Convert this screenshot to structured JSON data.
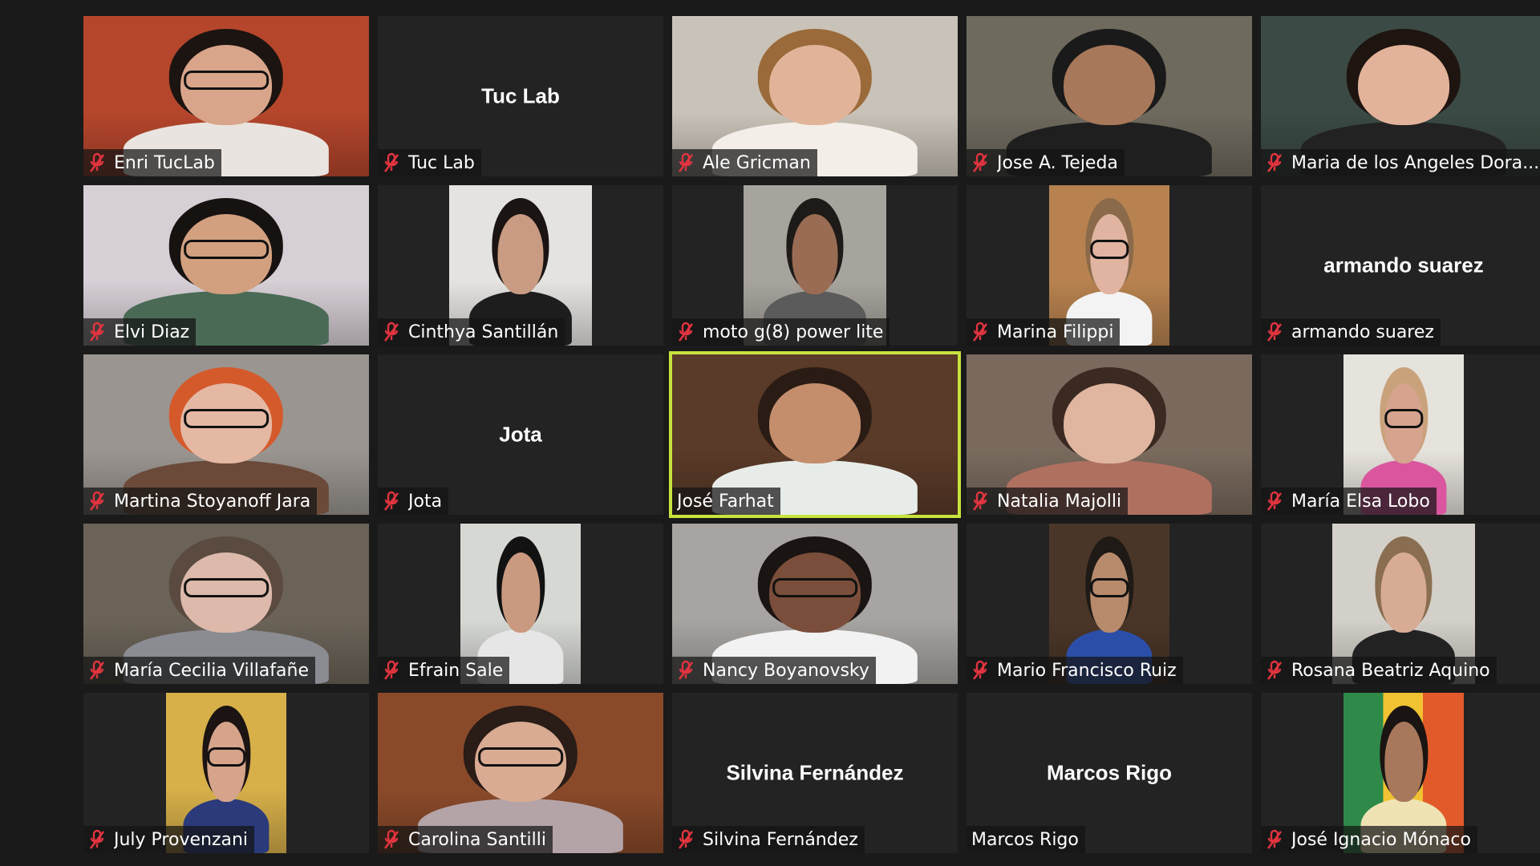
{
  "meeting": {
    "participants": [
      {
        "name": "Enri TucLab",
        "muted": true,
        "video": true,
        "bg": "#b5462c",
        "skin": "#d9a58a",
        "shirt": "#e9e4df",
        "hair": "#1c1410",
        "wide": true,
        "glasses": true
      },
      {
        "name": "Tuc Lab",
        "muted": true,
        "video": false,
        "display": "Tuc Lab"
      },
      {
        "name": "Ale Gricman",
        "muted": true,
        "video": true,
        "bg": "#c9c2b8",
        "skin": "#e1b49a",
        "shirt": "#f3eee8",
        "hair": "#9a6a3a",
        "wide": true
      },
      {
        "name": "Jose A. Tejeda",
        "muted": true,
        "video": true,
        "bg": "#6e6a5e",
        "skin": "#a8785a",
        "shirt": "#1f1f1f",
        "hair": "#1a1a1a",
        "wide": true
      },
      {
        "name": "Maria de los Angeles Dora...",
        "muted": true,
        "video": true,
        "bg": "#3b4a44",
        "skin": "#e2b39a",
        "shirt": "#222222",
        "hair": "#1e1410",
        "wide": true
      },
      {
        "name": "Elvi Diaz",
        "muted": true,
        "video": true,
        "bg": "#d7cfd6",
        "skin": "#d2a07f",
        "shirt": "#4a6a55",
        "hair": "#161210",
        "wide": true,
        "glasses": true
      },
      {
        "name": "Cinthya Santillán",
        "muted": true,
        "video": true,
        "bg": "#e4e3e1",
        "skin": "#c89b82",
        "shirt": "#1d1d1d",
        "hair": "#1a1412",
        "wide": false
      },
      {
        "name": "moto g(8) power lite",
        "muted": true,
        "video": true,
        "bg": "#a7a39d",
        "skin": "#9a6c54",
        "shirt": "#5b5b5b",
        "hair": "#1e1a18",
        "wide": false,
        "mid": true
      },
      {
        "name": "Marina Filippi",
        "muted": true,
        "video": true,
        "bg": "#b7824f",
        "skin": "#e0b4a0",
        "shirt": "#f3f3f3",
        "hair": "#8a6a4a",
        "wide": false,
        "vnarrow": true,
        "glasses": true
      },
      {
        "name": "armando suarez",
        "muted": true,
        "video": false,
        "display": "armando suarez"
      },
      {
        "name": "Martina Stoyanoff Jara",
        "muted": true,
        "video": true,
        "bg": "#9a9590",
        "skin": "#e5b8a4",
        "shirt": "#6b4a3a",
        "hair": "#d45a2c",
        "wide": true,
        "glasses": true
      },
      {
        "name": "Jota",
        "muted": true,
        "video": false,
        "display": "Jota"
      },
      {
        "name": "José Farhat",
        "muted": false,
        "video": true,
        "active": true,
        "bg": "#5a3a28",
        "skin": "#c48e6c",
        "shirt": "#e8ece8",
        "hair": "#2a1c14",
        "wide": true
      },
      {
        "name": "Natalia Majolli",
        "muted": true,
        "video": true,
        "bg": "#7a6a5e",
        "skin": "#e0b6a0",
        "shirt": "#b07060",
        "hair": "#3a2a22",
        "wide": true
      },
      {
        "name": "María Elsa Lobo",
        "muted": true,
        "video": true,
        "bg": "#e6e2dc",
        "skin": "#d6a48e",
        "shirt": "#d9569e",
        "hair": "#c9a27c",
        "wide": false,
        "vnarrow": true,
        "glasses": true
      },
      {
        "name": "María Cecilia Villafañe",
        "muted": true,
        "video": true,
        "bg": "#6b6358",
        "skin": "#dcb9aa",
        "shirt": "#8a8c92",
        "hair": "#5a4a40",
        "wide": true,
        "glasses": true
      },
      {
        "name": "Efrain Sale",
        "muted": true,
        "video": true,
        "bg": "#d6d8d4",
        "skin": "#c99a80",
        "shirt": "#e6e6e6",
        "hair": "#121212",
        "wide": false,
        "vnarrow": true
      },
      {
        "name": "Nancy Boyanovsky",
        "muted": true,
        "video": true,
        "bg": "#a7a4a1",
        "skin": "#7a4e3a",
        "shirt": "#f2f2f2",
        "hair": "#1a1412",
        "wide": true,
        "glasses": true
      },
      {
        "name": "Mario Francisco Ruiz",
        "muted": true,
        "video": true,
        "bg": "#4a3628",
        "skin": "#b78a6c",
        "shirt": "#2b4fa8",
        "hair": "#1f1a16",
        "wide": false,
        "vnarrow": true,
        "glasses": true
      },
      {
        "name": "Rosana Beatriz Aquino",
        "muted": true,
        "video": true,
        "bg": "#d3d0c9",
        "skin": "#d8ab94",
        "shirt": "#222222",
        "hair": "#8a6e52",
        "wide": false,
        "mid": true
      },
      {
        "name": "July Provenzani",
        "muted": true,
        "video": true,
        "bg": "#d7b04a",
        "skin": "#d6a48a",
        "shirt": "#2a3a7a",
        "hair": "#1c1412",
        "wide": false,
        "vnarrow": true,
        "glasses": true
      },
      {
        "name": "Carolina Santilli",
        "muted": true,
        "video": true,
        "bg": "#8a4a2a",
        "skin": "#d9ab92",
        "shirt": "#b4a4a8",
        "hair": "#2a1c16",
        "wide": true,
        "glasses": true
      },
      {
        "name": "Silvina Fernández",
        "muted": true,
        "video": false,
        "display": "Silvina Fernández"
      },
      {
        "name": "Marcos Rigo",
        "muted": false,
        "video": false,
        "display": "Marcos Rigo"
      },
      {
        "name": "José Ignacio Mónaco",
        "muted": true,
        "video": true,
        "bg": "#2f8a4a",
        "skin": "#a8785c",
        "shirt": "#efe3b4",
        "hair": "#1a1412",
        "wide": false,
        "vnarrow": true,
        "flag": true
      }
    ]
  },
  "colors": {
    "active_speaker_border": "#c7e33d",
    "muted_icon": "#e2343f",
    "tile_background": "#232323"
  },
  "icons": {
    "muted": "microphone-muted-icon"
  }
}
